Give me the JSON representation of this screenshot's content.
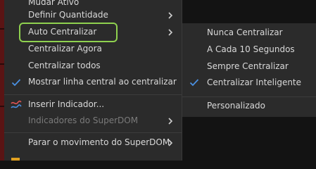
{
  "menu": {
    "items": [
      {
        "label": "Mudar Ativo"
      },
      {
        "label": "Definir Quantidade"
      },
      {
        "label": "Auto Centralizar"
      },
      {
        "label": "Centralizar Agora"
      },
      {
        "label": "Centralizar todos"
      },
      {
        "label": "Mostrar linha central ao centralizar"
      },
      {
        "label": "Inserir Indicador..."
      },
      {
        "label": "Indicadores do SuperDOM"
      },
      {
        "label": "Parar o movimento do SuperDOM"
      }
    ]
  },
  "submenu": {
    "items": [
      {
        "label": "Nunca Centralizar"
      },
      {
        "label": "A Cada 10 Segundos"
      },
      {
        "label": "Sempre Centralizar"
      },
      {
        "label": "Centralizar Inteligente"
      },
      {
        "label": "Personalizado"
      }
    ]
  },
  "colors": {
    "highlight_border": "#8fd14f",
    "check_blue": "#4a90e2",
    "menu_bg": "#2b2b2b",
    "disabled_text": "#7a7a7a"
  }
}
